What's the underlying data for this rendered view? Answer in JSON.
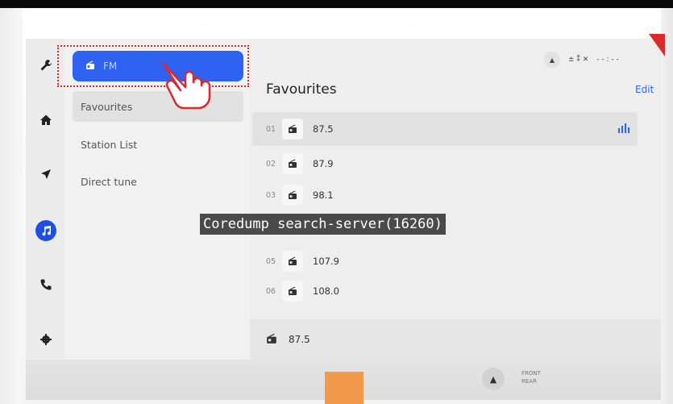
{
  "sidebar": {
    "rail_icons": [
      "wrench-icon",
      "home-icon",
      "navigation-icon",
      "music-icon",
      "phone-icon",
      "settings-icon"
    ],
    "source_label": "FM",
    "menu": [
      "Favourites",
      "Station List",
      "Direct tune"
    ]
  },
  "status_bar": {
    "items": [
      "▲",
      "±  ⁑ ✕",
      "- - : - -"
    ]
  },
  "main": {
    "title": "Favourites",
    "edit_label": "Edit",
    "favourites": [
      {
        "index": "01",
        "frequency": "87.5"
      },
      {
        "index": "02",
        "frequency": "87.9"
      },
      {
        "index": "03",
        "frequency": "98.1"
      },
      {
        "index": "05",
        "frequency": "107.9"
      },
      {
        "index": "06",
        "frequency": "108.0"
      }
    ],
    "now_playing": "87.5"
  },
  "bottom_bar": {
    "front_label": "FRONT",
    "rear_label": "REAR"
  },
  "overlay": {
    "banner_text": "Coredump search-server(16260)"
  },
  "colors": {
    "accent": "#2f62f0",
    "highlight_border": "#d92b2b",
    "orange_block": "#f29a4b"
  }
}
